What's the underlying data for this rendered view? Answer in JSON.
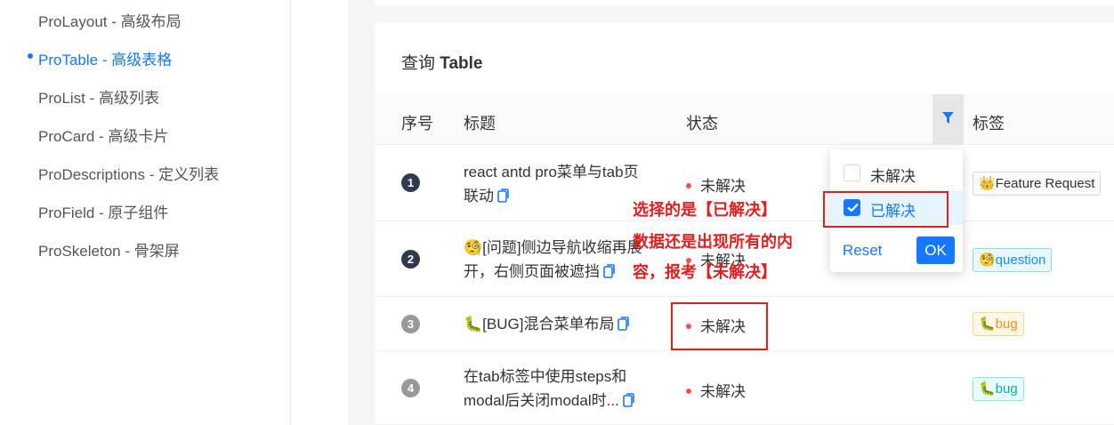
{
  "sidebar": {
    "items": [
      {
        "label": "ProLayout - 高级布局",
        "active": false
      },
      {
        "label": "ProTable - 高级表格",
        "active": true
      },
      {
        "label": "ProList - 高级列表",
        "active": false
      },
      {
        "label": "ProCard - 高级卡片",
        "active": false
      },
      {
        "label": "ProDescriptions - 定义列表",
        "active": false
      },
      {
        "label": "ProField - 原子组件",
        "active": false
      },
      {
        "label": "ProSkeleton - 骨架屏",
        "active": false
      }
    ]
  },
  "card": {
    "title_prefix": "查询 ",
    "title_bold": "Table"
  },
  "table": {
    "columns": {
      "index": "序号",
      "title": "标题",
      "status": "状态",
      "tags": "标签"
    },
    "rows": [
      {
        "index": "1",
        "title_line1": "react antd pro菜单与tab页",
        "title_line2": "联动",
        "status": "未解决",
        "tag": "👑Feature Request"
      },
      {
        "index": "2",
        "title_line1": "🧐[问题]侧边导航收缩再展",
        "title_line2": "开，右侧页面被遮挡",
        "status": "未解决",
        "tag": "🧐question"
      },
      {
        "index": "3",
        "title_line1": "🐛[BUG]混合菜单布局",
        "title_line2": "",
        "status": "未解决",
        "tag": "🐛bug"
      },
      {
        "index": "4",
        "title_line1": "在tab标签中使用steps和",
        "title_line2": "modal后关闭modal时...",
        "status": "未解决",
        "tag": "🐛bug"
      }
    ]
  },
  "filter_dropdown": {
    "options": [
      {
        "label": "未解决",
        "checked": false
      },
      {
        "label": "已解决",
        "checked": true
      }
    ],
    "reset_label": "Reset",
    "ok_label": "OK"
  },
  "annotations": {
    "line1": "选择的是【已解决】",
    "line2": "数据还是出现所有的内",
    "line3": "容，报考【未解决】"
  },
  "colors": {
    "accent": "#1677ff",
    "annotation": "#e02020",
    "status_dot": "#ff4d4f"
  }
}
